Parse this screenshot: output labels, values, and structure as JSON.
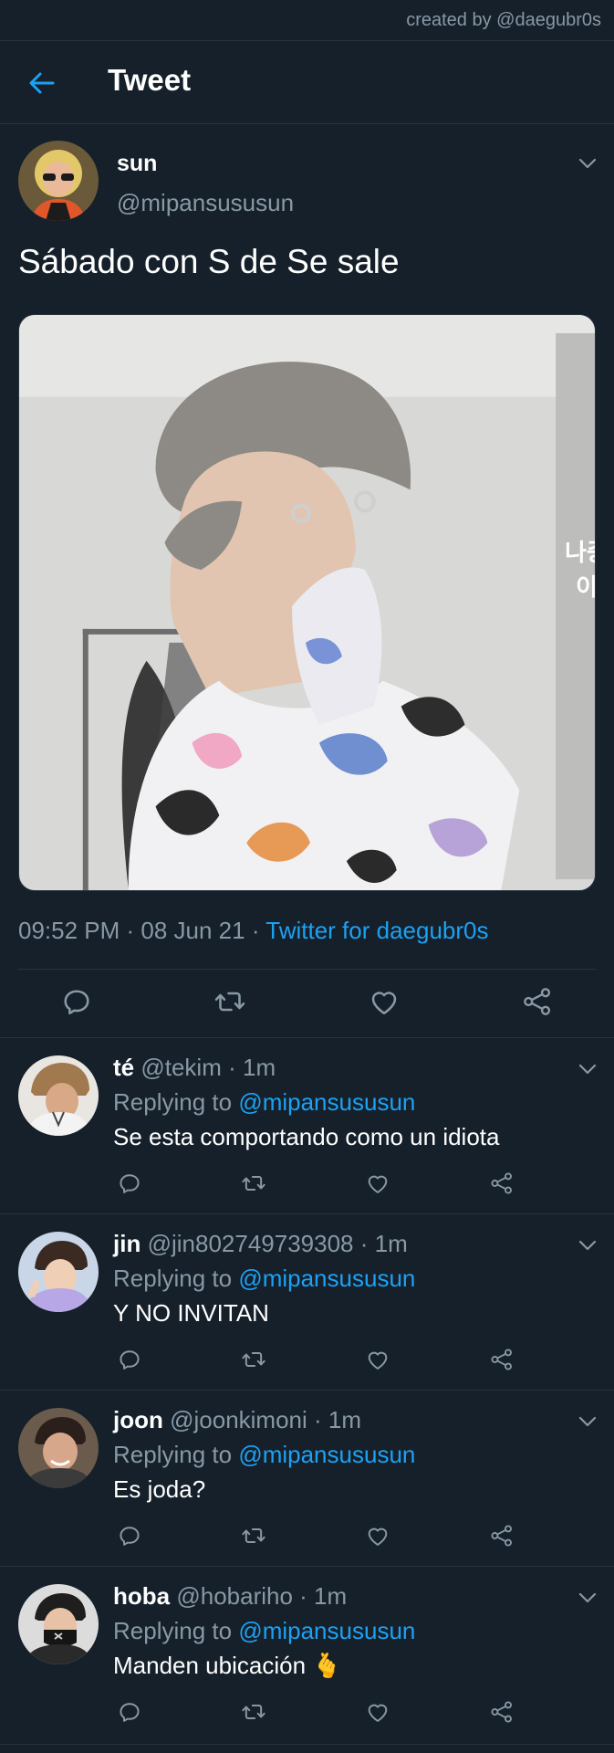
{
  "credit": "created by @daegubr0s",
  "header": {
    "title": "Tweet"
  },
  "tweet": {
    "name": "sun",
    "handle": "@mipansususun",
    "text": "Sábado con S de Se sale",
    "time": "09:52 PM · 08 Jun 21 · ",
    "source": "Twitter for daegubr0s"
  },
  "replies": [
    {
      "name": "té",
      "handle": "@tekim",
      "time": " · 1m",
      "replying_label": "Replying to ",
      "mention": "@mipansususun",
      "text": "Se esta comportando como un idiota"
    },
    {
      "name": "jin",
      "handle": "@jin802749739308",
      "time": " · 1m",
      "replying_label": "Replying to ",
      "mention": "@mipansususun",
      "text": "Y NO INVITAN"
    },
    {
      "name": "joon",
      "handle": "@joonkimoni",
      "time": " · 1m",
      "replying_label": "Replying to ",
      "mention": "@mipansususun",
      "text": "Es joda?"
    },
    {
      "name": "hoba",
      "handle": "@hobariho",
      "time": " · 1m",
      "replying_label": "Replying to ",
      "mention": "@mipansususun",
      "text": "Manden ubicación 🫰"
    }
  ],
  "colors": {
    "background": "#15202b",
    "accent": "#1da1f2",
    "muted": "#8899a6",
    "divider": "#263340"
  },
  "icons": [
    "back-arrow-icon",
    "chevron-down-icon",
    "reply-icon",
    "retweet-icon",
    "like-icon",
    "share-icon"
  ],
  "media": {
    "overlay_text": [
      "나중",
      "이"
    ]
  }
}
